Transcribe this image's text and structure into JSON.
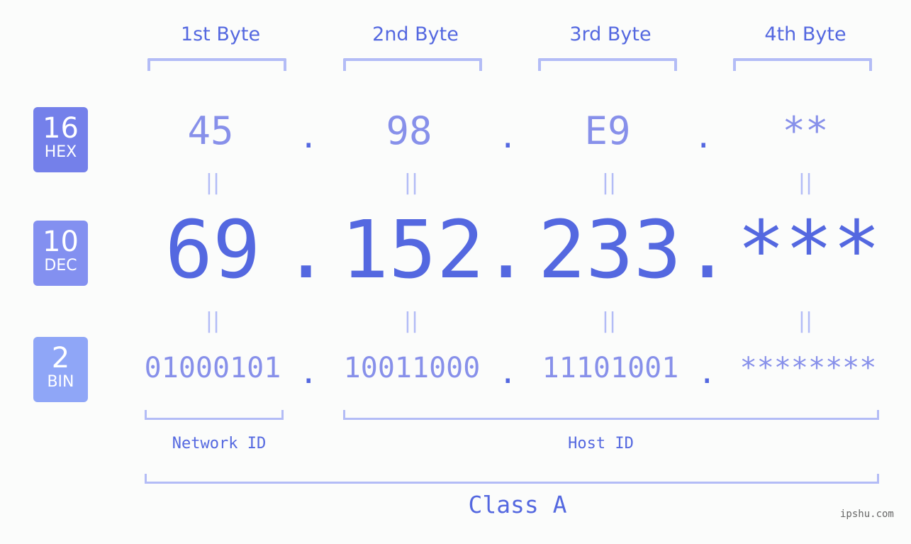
{
  "bytes": [
    {
      "label": "1st Byte",
      "hex": "45",
      "dec": "69",
      "bin": "01000101"
    },
    {
      "label": "2nd Byte",
      "hex": "98",
      "dec": "152",
      "bin": "10011000"
    },
    {
      "label": "3rd Byte",
      "hex": "E9",
      "dec": "233",
      "bin": "11101001"
    },
    {
      "label": "4th Byte",
      "hex": "**",
      "dec": "***",
      "bin": "********"
    }
  ],
  "separator": ".",
  "equals": "||",
  "bases": {
    "hex": {
      "num": "16",
      "name": "HEX",
      "color": "#7480ea"
    },
    "dec": {
      "num": "10",
      "name": "DEC",
      "color": "#8390f0"
    },
    "bin": {
      "num": "2",
      "name": "BIN",
      "color": "#8fa6f7"
    }
  },
  "network_id_label": "Network ID",
  "host_id_label": "Host ID",
  "class_label": "Class A",
  "watermark": "ipshu.com",
  "colors": {
    "accent": "#5468e0",
    "light": "#8790ea",
    "bracket": "#b3bcf6"
  }
}
